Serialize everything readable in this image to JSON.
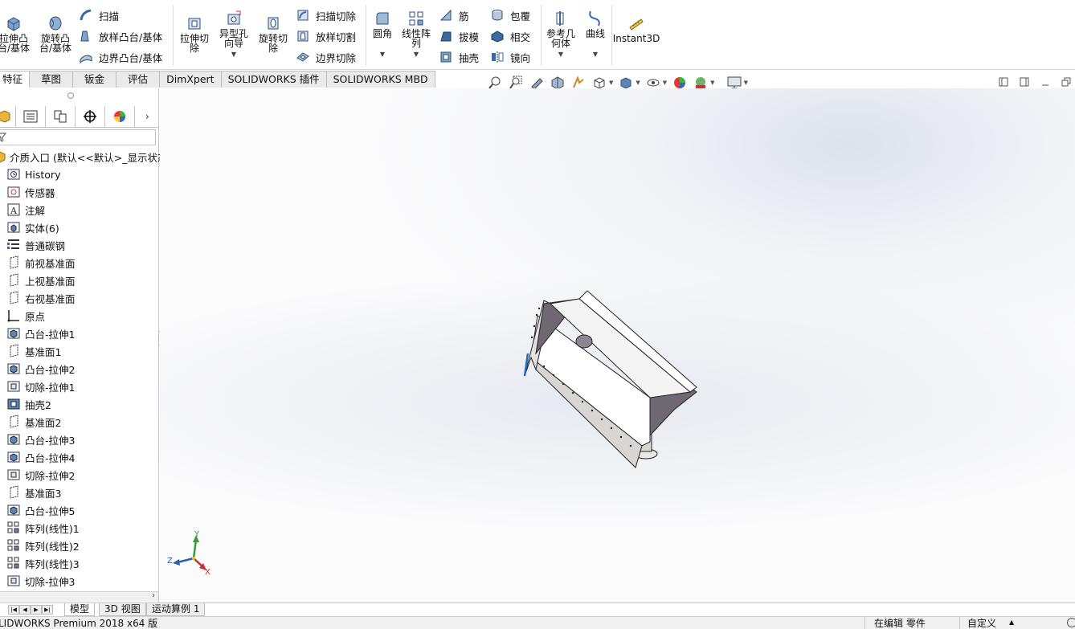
{
  "ribbon": {
    "extrude_boss": "拉伸凸\n台/基体",
    "revolve_boss": "旋转凸\n台/基体",
    "sweep": "扫描",
    "loft_boss": "放样凸台/基体",
    "boundary_boss": "边界凸台/基体",
    "extrude_cut": "拉伸切\n除",
    "hole_wizard": "异型孔\n向导",
    "revolve_cut": "旋转切\n除",
    "swept_cut": "扫描切除",
    "lofted_cut": "放样切割",
    "boundary_cut": "边界切除",
    "fillet": "圆角",
    "linear_pattern": "线性阵\n列",
    "rib": "筋",
    "draft": "拔模",
    "shell": "抽壳",
    "wrap": "包覆",
    "intersect": "相交",
    "mirror": "镜向",
    "ref_geometry": "参考几\n何体",
    "curves": "曲线",
    "instant3d": "Instant3D"
  },
  "command_tabs": [
    {
      "label": "特征",
      "active": true
    },
    {
      "label": "草图"
    },
    {
      "label": "钣金"
    },
    {
      "label": "评估"
    },
    {
      "label": "DimXpert"
    },
    {
      "label": "SOLIDWORKS 插件"
    },
    {
      "label": "SOLIDWORKS MBD"
    }
  ],
  "tree": {
    "root_label": "介质入口 (默认<<默认>_显示状态",
    "items": [
      {
        "label": "History",
        "icon": "history-icon"
      },
      {
        "label": "传感器",
        "icon": "sensor-icon"
      },
      {
        "label": "注解",
        "icon": "annotation-icon"
      },
      {
        "label": "实体(6)",
        "icon": "solid-bodies-icon"
      },
      {
        "label": "普通碳钢",
        "icon": "material-icon"
      },
      {
        "label": "前视基准面",
        "icon": "plane-icon"
      },
      {
        "label": "上视基准面",
        "icon": "plane-icon"
      },
      {
        "label": "右视基准面",
        "icon": "plane-icon"
      },
      {
        "label": "原点",
        "icon": "origin-icon"
      },
      {
        "label": "凸台-拉伸1",
        "icon": "boss-extrude-icon"
      },
      {
        "label": "基准面1",
        "icon": "plane-icon"
      },
      {
        "label": "凸台-拉伸2",
        "icon": "boss-extrude-icon"
      },
      {
        "label": "切除-拉伸1",
        "icon": "cut-extrude-icon"
      },
      {
        "label": "抽壳2",
        "icon": "shell-icon"
      },
      {
        "label": "基准面2",
        "icon": "plane-icon"
      },
      {
        "label": "凸台-拉伸3",
        "icon": "boss-extrude-icon"
      },
      {
        "label": "凸台-拉伸4",
        "icon": "boss-extrude-icon"
      },
      {
        "label": "切除-拉伸2",
        "icon": "cut-extrude-icon"
      },
      {
        "label": "基准面3",
        "icon": "plane-icon"
      },
      {
        "label": "凸台-拉伸5",
        "icon": "boss-extrude-icon"
      },
      {
        "label": "阵列(线性)1",
        "icon": "linear-pattern-icon"
      },
      {
        "label": "阵列(线性)2",
        "icon": "linear-pattern-icon"
      },
      {
        "label": "阵列(线性)3",
        "icon": "linear-pattern-icon"
      },
      {
        "label": "切除-拉伸3",
        "icon": "cut-extrude-icon"
      }
    ]
  },
  "triad": {
    "x": "X",
    "y": "Y",
    "z": "Z"
  },
  "bottom_tabs": [
    {
      "label": "模型",
      "active": true
    },
    {
      "label": "3D 视图"
    },
    {
      "label": "运动算例 1"
    }
  ],
  "status": {
    "app": "LIDWORKS Premium 2018 x64 版",
    "mode": "在编辑 零件",
    "units": "自定义"
  },
  "colors": {
    "accent": "#1f6fc5",
    "part_dark": "#6f6873",
    "part_light": "#ffffff",
    "part_mid": "#d8d6d2"
  }
}
